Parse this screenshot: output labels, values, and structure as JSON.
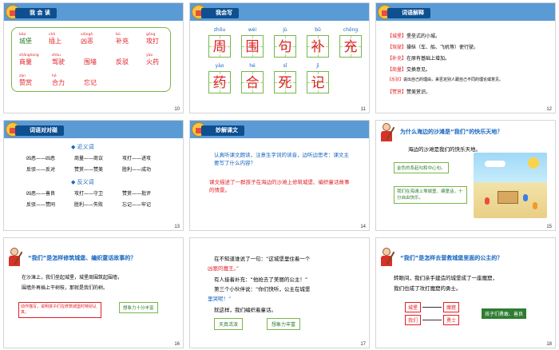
{
  "slides": [
    {
      "number": "10",
      "header": "我 会 读",
      "words": [
        {
          "py": "bǎo",
          "text": "城堡"
        },
        {
          "py": "chā",
          "text": "插上"
        },
        {
          "py": "xiōngè",
          "text": "凶恶"
        },
        {
          "py": "bǔ",
          "text": "补充"
        },
        {
          "py": "gōng",
          "text": "攻打"
        },
        {
          "py": "shāngliang",
          "text": "商量"
        },
        {
          "py": "zhòu",
          "text": "驾驶"
        },
        {
          "py": "",
          "text": "围墙"
        },
        {
          "py": "",
          "text": "反驳"
        },
        {
          "py": "yào",
          "text": "火药"
        },
        {
          "py": "zàn",
          "text": "赞赏"
        },
        {
          "py": "hé",
          "text": "合力"
        },
        {
          "py": "",
          "text": "忘记"
        }
      ]
    },
    {
      "number": "11",
      "header": "我会写",
      "chars": [
        {
          "py": "zhōu",
          "ch": "周"
        },
        {
          "py": "wéi",
          "ch": "围"
        },
        {
          "py": "jù",
          "ch": "句"
        },
        {
          "py": "bǔ",
          "ch": "补"
        },
        {
          "py": "chōng",
          "ch": "充"
        },
        {
          "py": "yào",
          "ch": "药"
        },
        {
          "py": "hé",
          "ch": "合"
        },
        {
          "py": "sǐ",
          "ch": "死"
        },
        {
          "py": "jì",
          "ch": "记"
        }
      ]
    },
    {
      "number": "12",
      "header": "词语解释",
      "defs": [
        {
          "k": "【城堡】",
          "v": "堡垒式的小城。"
        },
        {
          "k": "【驾驶】",
          "v": "操纵（车、船、飞机等）使行驶。"
        },
        {
          "k": "【补充】",
          "v": "在原有基础上增加。"
        },
        {
          "k": "【商量】",
          "v": "交换意见。"
        },
        {
          "k": "【反驳】",
          "v": "说出自己的理由，来否定别人跟自己不同的理论或意见。"
        },
        {
          "k": "【赞赏】",
          "v": "赞美赏识。"
        }
      ]
    },
    {
      "number": "13",
      "header": "词语对对碰",
      "syn_title": "近义词",
      "syn": [
        [
          "凶恶——凶恶",
          "商量——商议",
          "攻打——进攻"
        ],
        [
          "反驳——反对",
          "赞赏——赞美",
          "胜利——成功"
        ]
      ],
      "ant_title": "反义词",
      "ant": [
        [
          "凶恶——善良",
          "攻打——守卫",
          "赞赏——批评"
        ],
        [
          "反驳——赞同",
          "胜利——失败",
          "忘记——牢记"
        ]
      ]
    },
    {
      "number": "14",
      "header": "妙解课文",
      "para1": "认真听课文朗读，注意生字词的读音，边听边思考：课文主要写了什么内容？",
      "para2": "课文描述了一群孩子在海边的沙滩上修筑城堡、编织童话故事的情景。"
    },
    {
      "number": "15",
      "question": "为什么海边的沙滩是“我们”的快乐天地？",
      "text": "海边的沙滩是我们的快乐天地。",
      "box1": "金色的系起勾和中心句。",
      "box2": "我们在海滩上堆城堡、编童话，十分自由快乐。"
    },
    {
      "number": "16",
      "question": "“我们”是怎样修筑城堡、编织童话故事的？",
      "line1": "在沙滩上，我们垒起城堡，城堡周围筑起围墙，",
      "line2": "围墙外再插上干树枝，那就是我们的树。",
      "note": "动作描写，说明孩子们在修筑城堡时特别认真。",
      "tag": "想象力十分丰富"
    },
    {
      "number": "17",
      "l1": "在不知道谁说了一句：“这城堡里住着一个",
      "l2": "凶狠的魔王。”",
      "l3": "有人接着补充：“他抢去了美丽的公主！”",
      "l4": "第三个小伙伴说：“你们快听，公主在城堡",
      "l5": "里哭呢！”",
      "l6": "就这样，我们编织着童话。",
      "tag1": "天真活泼",
      "tag2": "想象力丰富"
    },
    {
      "number": "18",
      "question": "“我们”是怎样去营救城堡里面的公主的？",
      "l1": "转眼间，我们亲手建造的城堡成了一座魔窟，",
      "l2": "我们也成了攻打魔窟的勇士。",
      "b1": "城堡",
      "b2": "魔窟",
      "b3": "我们",
      "b4": "勇士",
      "tag": "孩子们勇敢、善良"
    }
  ]
}
